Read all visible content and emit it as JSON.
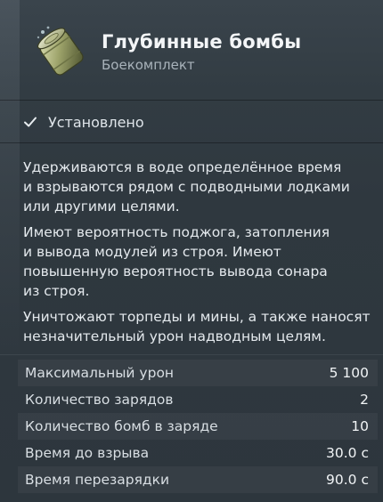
{
  "header": {
    "title": "Глубинные бомбы",
    "subtitle": "Боекомплект",
    "icon": "depth-charge-icon"
  },
  "status": {
    "label": "Установлено",
    "icon": "checkmark-icon"
  },
  "description": [
    "Удерживаются в воде определённое время\nи взрываются рядом с подводными лодками\nили другими целями.",
    "Имеют вероятность поджога, затопления\nи вывода модулей из строя. Имеют\nповышенную вероятность вывода сонара\nиз строя.",
    "Уничтожают торпеды и мины, а также наносят\nнезначительный урон надводным целям."
  ],
  "stats": [
    {
      "label": "Максимальный урон",
      "value": "5 100"
    },
    {
      "label": "Количество зарядов",
      "value": "2"
    },
    {
      "label": "Количество бомб в заряде",
      "value": "10"
    },
    {
      "label": "Время до взрыва",
      "value": "30.0 с"
    },
    {
      "label": "Время перезарядки",
      "value": "90.0 с"
    }
  ],
  "colors": {
    "background": "#2f383f",
    "text": "#e6ebef",
    "muted": "#a9b3bb"
  }
}
